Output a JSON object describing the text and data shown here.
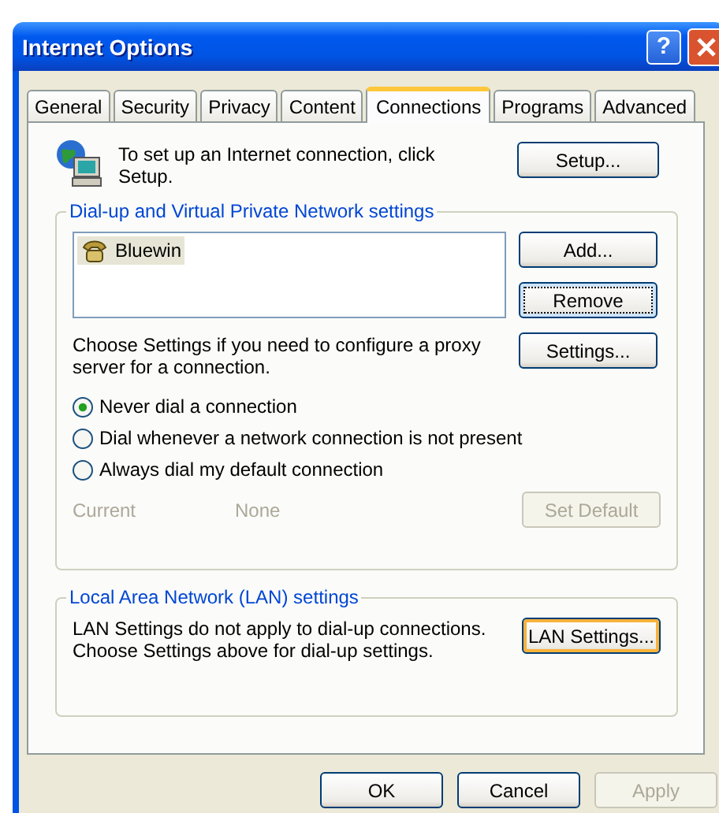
{
  "window": {
    "title": "Internet Options",
    "help_label": "?"
  },
  "tabs": [
    {
      "label": "General",
      "selected": false
    },
    {
      "label": "Security",
      "selected": false
    },
    {
      "label": "Privacy",
      "selected": false
    },
    {
      "label": "Content",
      "selected": false
    },
    {
      "label": "Connections",
      "selected": true
    },
    {
      "label": "Programs",
      "selected": false
    },
    {
      "label": "Advanced",
      "selected": false
    }
  ],
  "setup": {
    "text": "To set up an Internet connection, click Setup.",
    "button": {
      "label": "Setup...",
      "focused": false,
      "default": false,
      "disabled": false
    }
  },
  "dialup": {
    "legend": "Dial-up and Virtual Private Network settings",
    "connections": [
      {
        "name": "Bluewin",
        "selected": true
      }
    ],
    "buttons": [
      {
        "label": "Add...",
        "focused": false,
        "default": false,
        "disabled": false
      },
      {
        "label": "Remove",
        "focused": true,
        "default": false,
        "disabled": false
      },
      {
        "label": "Settings...",
        "focused": false,
        "default": false,
        "disabled": false
      }
    ],
    "proxy_text": "Choose Settings if you need to configure a proxy server for a connection.",
    "radios": [
      {
        "label": "Never dial a connection",
        "selected": true
      },
      {
        "label": "Dial whenever a network connection is not present",
        "selected": false
      },
      {
        "label": "Always dial my default connection",
        "selected": false
      }
    ],
    "current_label": "Current",
    "current_value": "None",
    "set_default": {
      "label": "Set Default",
      "focused": false,
      "default": false,
      "disabled": true
    }
  },
  "lan": {
    "legend": "Local Area Network (LAN) settings",
    "text": "LAN Settings do not apply to dial-up connections. Choose Settings above for dial-up settings.",
    "button": {
      "label": "LAN Settings...",
      "focused": false,
      "default": true,
      "disabled": false
    }
  },
  "footer_buttons": [
    {
      "label": "OK",
      "focused": false,
      "default": false,
      "disabled": false
    },
    {
      "label": "Cancel",
      "focused": false,
      "default": false,
      "disabled": false
    },
    {
      "label": "Apply",
      "focused": false,
      "default": false,
      "disabled": true
    }
  ]
}
